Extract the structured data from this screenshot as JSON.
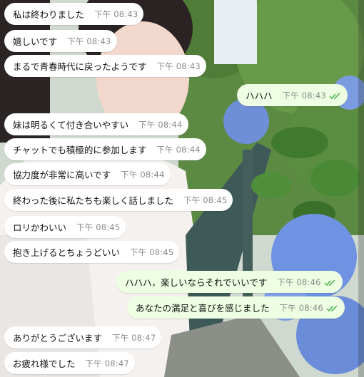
{
  "theme": {
    "incoming_bg": "#ffffff",
    "outgoing_bg": "#eefee2",
    "tick_color": "#4caf50",
    "time_color": "#8a8a8a"
  },
  "messages": [
    {
      "text": "私は終わりました",
      "time": "下午 08:43",
      "direction": "in"
    },
    {
      "text": "嬉しいです",
      "time": "下午 08:43",
      "direction": "in"
    },
    {
      "text": "まるで青春時代に戻ったようです",
      "time": "下午 08:43",
      "direction": "in"
    },
    {
      "text": "ハハハ",
      "time": "下午 08:43",
      "direction": "out",
      "status": "read"
    },
    {
      "text": "妹は明るくて付き合いやすい",
      "time": "下午 08:44",
      "direction": "in"
    },
    {
      "text": "チャットでも積極的に参加します",
      "time": "下午 08:44",
      "direction": "in"
    },
    {
      "text": "協力度が非常に高いです",
      "time": "下午 08:44",
      "direction": "in"
    },
    {
      "text": "終わった後に私たちも楽しく話しました",
      "time": "下午 08:45",
      "direction": "in"
    },
    {
      "text": "ロリかわいい",
      "time": "下午 08:45",
      "direction": "in"
    },
    {
      "text": "抱き上げるとちょうどいい",
      "time": "下午 08:45",
      "direction": "in"
    },
    {
      "text": "ハハハ，楽しいならそれでいいです",
      "time": "下午 08:46",
      "direction": "out",
      "status": "read"
    },
    {
      "text": "あなたの満足と喜びを感じました",
      "time": "下午 08:46",
      "direction": "out",
      "status": "read"
    },
    {
      "text": "ありがとうございます",
      "time": "下午 08:47",
      "direction": "in"
    },
    {
      "text": "お疲れ様でした",
      "time": "下午 08:47",
      "direction": "in"
    }
  ]
}
